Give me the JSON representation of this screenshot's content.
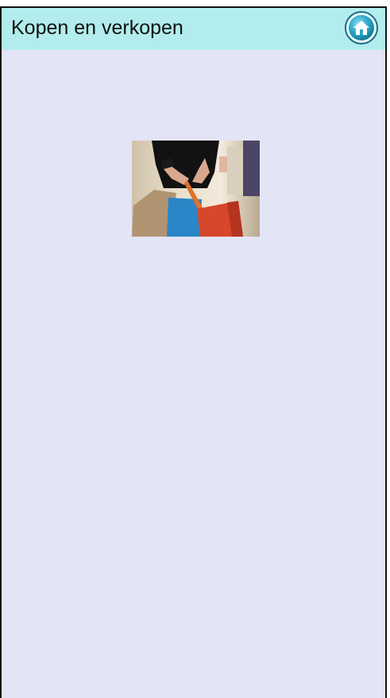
{
  "header": {
    "title": "Kopen en verkopen",
    "home_icon": "home-icon"
  },
  "main": {
    "image_icon": "shopping-bags-photo"
  },
  "colors": {
    "header_bg": "#b2ecec",
    "page_bg": "#e4e4f7",
    "home_button_bg": "#2aa6c8"
  }
}
